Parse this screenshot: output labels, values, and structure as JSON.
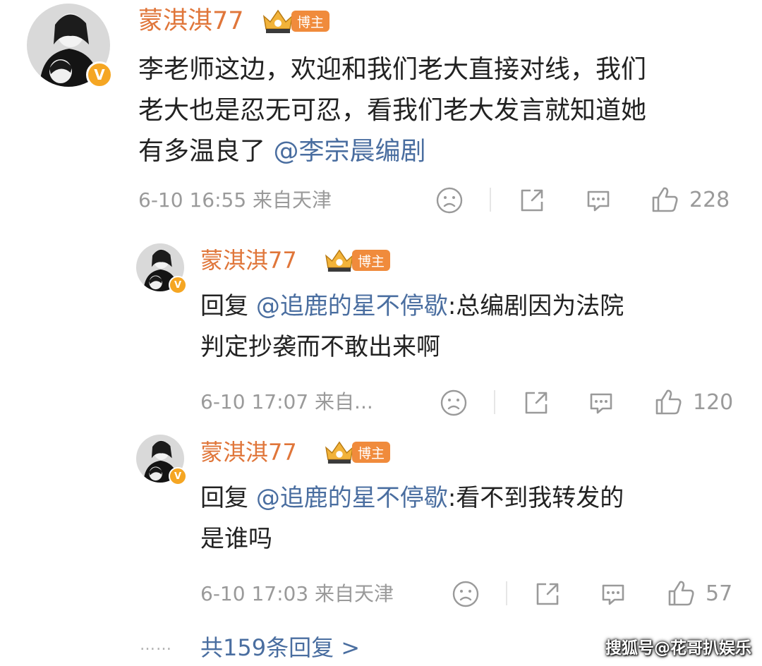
{
  "colors": {
    "username": "#e0763a",
    "mention": "#4a6ea0",
    "meta": "#9a9a9a",
    "badge_bg": "#f08b3c",
    "verified": "#f5a623"
  },
  "icons": {
    "avatar": "avatar-photo",
    "verified": "verified-v-icon",
    "crown": "crown-icon",
    "dislike": "sad-face-icon",
    "share": "share-icon",
    "comment": "comment-icon",
    "like": "thumbs-up-icon"
  },
  "comment": {
    "username": "蒙淇淇77",
    "badge_label": "博主",
    "verified_label": "V",
    "crown_level": "II",
    "lines": [
      "李老师这边，欢迎和我们老大直接对线，我们",
      "老大也是忍无可忍，看我们老大发言就知道她"
    ],
    "line3_prefix": "有多温良了",
    "line3_mention": "@李宗晨编剧",
    "meta": "6-10 16:55 来自天津",
    "likes": "228"
  },
  "replies": [
    {
      "username": "蒙淇淇77",
      "badge_label": "博主",
      "verified_label": "V",
      "crown_level": "II",
      "reply_prefix": "回复",
      "mention": "@追鹿的星不停歇",
      "line1_rest": ":总编剧因为法院",
      "line2": "判定抄袭而不敢出来啊",
      "meta": "6-10 17:07 来自...",
      "likes": "120"
    },
    {
      "username": "蒙淇淇77",
      "badge_label": "博主",
      "verified_label": "V",
      "crown_level": "II",
      "reply_prefix": "回复",
      "mention": "@追鹿的星不停歇",
      "line1_rest": ":看不到我转发的",
      "line2": "是谁吗",
      "meta": "6-10 17:03 来自天津",
      "likes": "57"
    }
  ],
  "footer": {
    "dots": "……",
    "more_replies": "共159条回复 >"
  },
  "watermark": "搜狐号@花哥扒娱乐"
}
